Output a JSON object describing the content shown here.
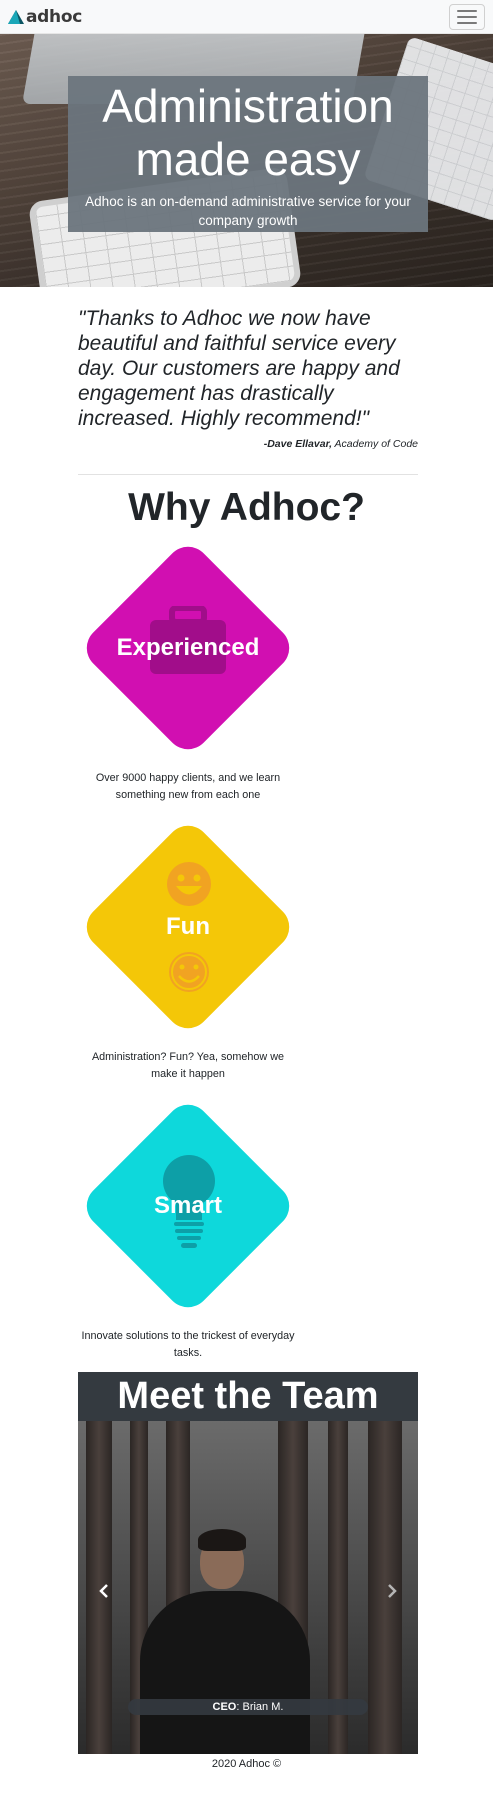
{
  "navbar": {
    "brand": "adhoc",
    "colors": {
      "logo_front": "#1aa7b8",
      "logo_back": "#0b5563"
    },
    "menu_icon": "hamburger-icon"
  },
  "hero": {
    "title": "Administration made easy",
    "subtitle": "Adhoc is an on-demand administrative service for your company growth"
  },
  "testimonial": {
    "quote": "\"Thanks to Adhoc we now have beautiful and faithful service every day. Our customers are happy and engagement has drastically increased. Highly recommend!\"",
    "author": "-Dave Ellavar,",
    "company": "Academy of Code"
  },
  "why": {
    "title": "Why Adhoc?",
    "features": [
      {
        "label": "Experienced",
        "description": "Over 9000 happy clients, and we learn something new from each one",
        "color": "#d10fb1",
        "icon": "briefcase-icon"
      },
      {
        "label": "Fun",
        "description": "Administration? Fun? Yea, somehow we make it happen",
        "color": "#f4c708",
        "icon": "smiley-icon"
      },
      {
        "label": "Smart",
        "description": "Innovate solutions to the trickest of everyday tasks.",
        "color": "#0ed8db",
        "icon": "lightbulb-icon"
      }
    ]
  },
  "team": {
    "title": "Meet the Team",
    "caption_role": "CEO",
    "caption_name": ": Brian M.",
    "prev_icon": "chevron-left-icon",
    "next_icon": "chevron-right-icon"
  },
  "footer": {
    "text": "2020 Adhoc ©"
  }
}
